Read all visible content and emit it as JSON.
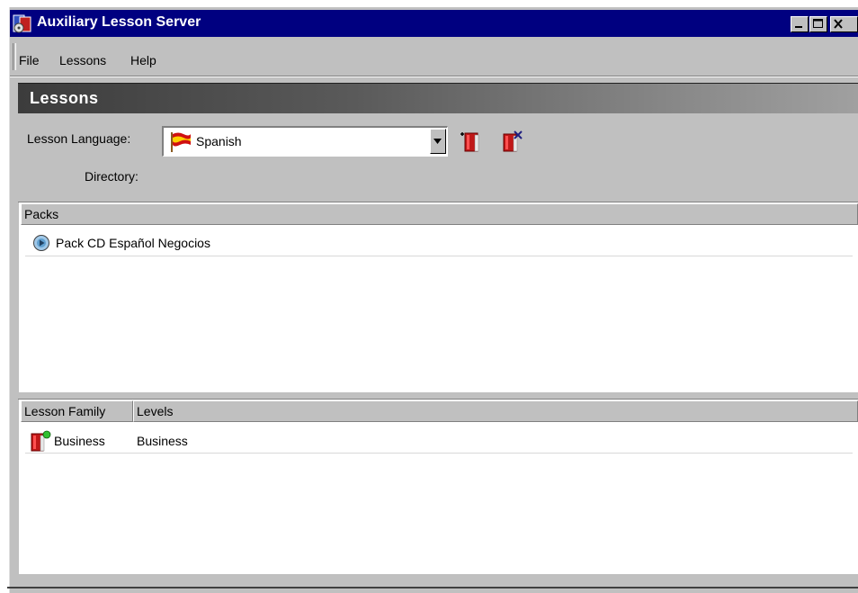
{
  "window": {
    "title": "Auxiliary Lesson Server",
    "controls": [
      "minimize",
      "maximize",
      "close"
    ]
  },
  "menu": {
    "items": [
      "File",
      "Lessons",
      "Help"
    ]
  },
  "section": {
    "title": "Lessons"
  },
  "form": {
    "language_label": "Lesson Language:",
    "language_value": "Spanish",
    "directory_label": "Directory:"
  },
  "toolbar": {
    "icons": [
      "add-lesson-icon",
      "remove-lesson-icon"
    ]
  },
  "packs": {
    "header": "Packs",
    "rows": [
      {
        "label": "Pack CD Español Negocios",
        "icon": "cd-icon"
      }
    ]
  },
  "families": {
    "headers": [
      "Lesson Family",
      "Levels"
    ],
    "rows": [
      {
        "family": "Business",
        "levels": "Business",
        "icon": "lesson-book-icon"
      }
    ]
  },
  "colors": {
    "titlebar": "#000080",
    "face": "#c0c0c0",
    "header_gradient_start": "#3c3c3c"
  }
}
